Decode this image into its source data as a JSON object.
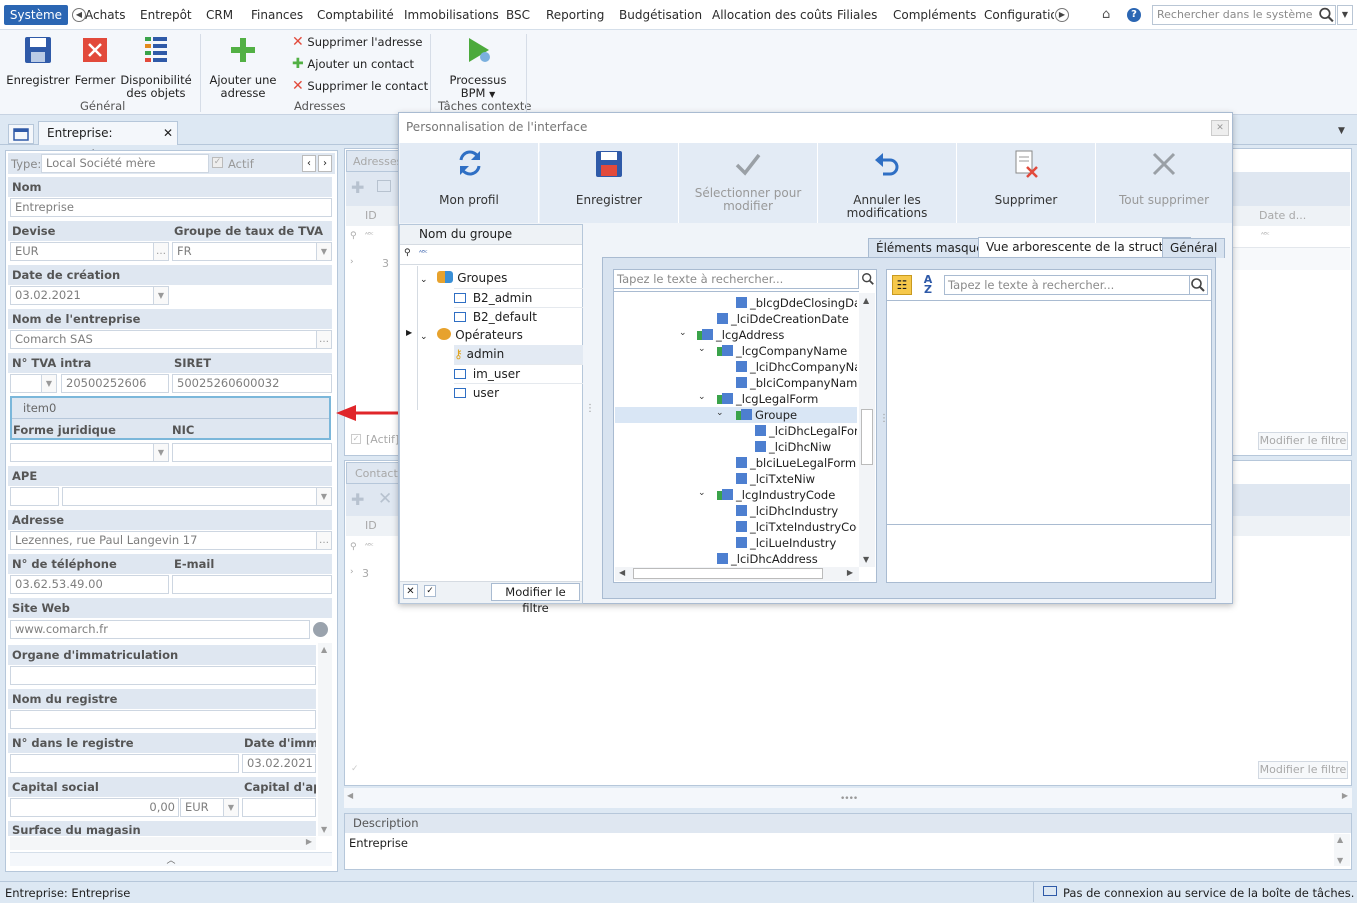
{
  "menu": {
    "system": "Système",
    "items": [
      "Achats",
      "Entrepôt",
      "CRM",
      "Finances",
      "Comptabilité",
      "Immobilisations",
      "BSC",
      "Reporting",
      "Budgétisation",
      "Allocation des coûts",
      "Filiales",
      "Compléments",
      "Configuration"
    ],
    "search_placeholder": "Rechercher dans le système"
  },
  "ribbon": {
    "save": "Enregistrer",
    "close": "Fermer",
    "availability_1": "Disponibilité",
    "availability_2": "des objets",
    "group_general": "Général",
    "add_address_1": "Ajouter une",
    "add_address_2": "adresse",
    "delete_address": "Supprimer l'adresse",
    "add_contact": "Ajouter un contact",
    "delete_contact": "Supprimer le contact",
    "group_addresses": "Adresses",
    "bpm_1": "Processus",
    "bpm_2": "BPM",
    "group_context": "Tâches contexte"
  },
  "doc_tab": "Entreprise: Entreprise",
  "form": {
    "type_label": "Type:",
    "type_value": "Local Société mère",
    "active": "Actif",
    "name_label": "Nom",
    "name_value": "Entreprise",
    "currency_label": "Devise",
    "vat_group_label": "Groupe de taux de TVA",
    "currency_value": "EUR",
    "vat_group_value": "FR",
    "creation_label": "Date de création",
    "creation_value": "03.02.2021",
    "company_label": "Nom de l'entreprise",
    "company_value": "Comarch SAS",
    "vat_intra_label": "N° TVA intra",
    "siret_label": "SIRET",
    "vat_intra_value": "20500252606",
    "siret_value": "50025260600032",
    "item0": "item0",
    "legal_form_label": "Forme juridique",
    "nic_label": "NIC",
    "ape_label": "APE",
    "address_label": "Adresse",
    "address_value": "Lezennes, rue Paul Langevin 17",
    "phone_label": "N° de téléphone",
    "email_label": "E-mail",
    "phone_value": "03.62.53.49.00",
    "website_label": "Site Web",
    "website_value": "www.comarch.fr",
    "registry_org_label": "Organe d'immatriculation",
    "registry_name_label": "Nom du registre",
    "registry_no_label": "N° dans le registre",
    "registry_date_label": "Date d'immatr",
    "registry_date_value": "03.02.2021",
    "capital_label": "Capital social",
    "capital_contrib_label": "Capital d'appo",
    "capital_value": "0,00",
    "capital_currency": "EUR",
    "store_surface_label": "Surface du magasin"
  },
  "background": {
    "addresses_tab": "Adresses",
    "contacts_tab": "Contacts",
    "id_col": "ID",
    "date_col": "Date d...",
    "row_count": "3",
    "active_filter": "[Actif]",
    "modify_filter": "Modifier le filtre",
    "description_label": "Description",
    "description_value": "Entreprise"
  },
  "dialog": {
    "title": "Personnalisation de l'interface",
    "toolbar": {
      "my_profile": "Mon profil",
      "save": "Enregistrer",
      "select_1": "Sélectionner pour",
      "select_2": "modifier",
      "undo": "Annuler les modifications",
      "delete": "Supprimer",
      "delete_all": "Tout supprimer"
    },
    "groups": {
      "header": "Nom du groupe",
      "groups_node": "Groupes",
      "b2_admin": "B2_admin",
      "b2_default": "B2_default",
      "operators_node": "Opérateurs",
      "admin": "admin",
      "im_user": "im_user",
      "user": "user",
      "modify_filter": "Modifier le filtre"
    },
    "tabs": {
      "hidden": "Éléments masqués",
      "tree": "Vue arborescente de la structure",
      "general": "Général"
    },
    "search_placeholder": "Tapez le texte à rechercher...",
    "tree_nodes": {
      "n1": "_blcgDdeClosingDa",
      "n2": "_lciDdeCreationDate",
      "n3": "_lcgAddress",
      "n4": "_lcgCompanyName",
      "n5": "_lciDhcCompanyNar",
      "n6": "_blciCompanyName",
      "n7": "_lcgLegalForm",
      "n8": "Groupe",
      "n9": "_lciDhcLegalForr",
      "n10": "_lciDhcNiw",
      "n11": "_blciLueLegalForm",
      "n12": "_lciTxteNiw",
      "n13": "_lcgIndustryCode",
      "n14": "_lciDhcIndustry",
      "n15": "_lciTxteIndustryCod",
      "n16": "_lciLueIndustry",
      "n17": "_lciDhcAddress"
    }
  },
  "status": {
    "left": "Entreprise: Entreprise",
    "right": "Pas de connexion au service de la boîte de tâches."
  },
  "colors": {
    "accent": "#2b66b3",
    "arrow": "#e0262a",
    "node_blue": "#4d7fd0",
    "node_green": "#3aa34a"
  }
}
